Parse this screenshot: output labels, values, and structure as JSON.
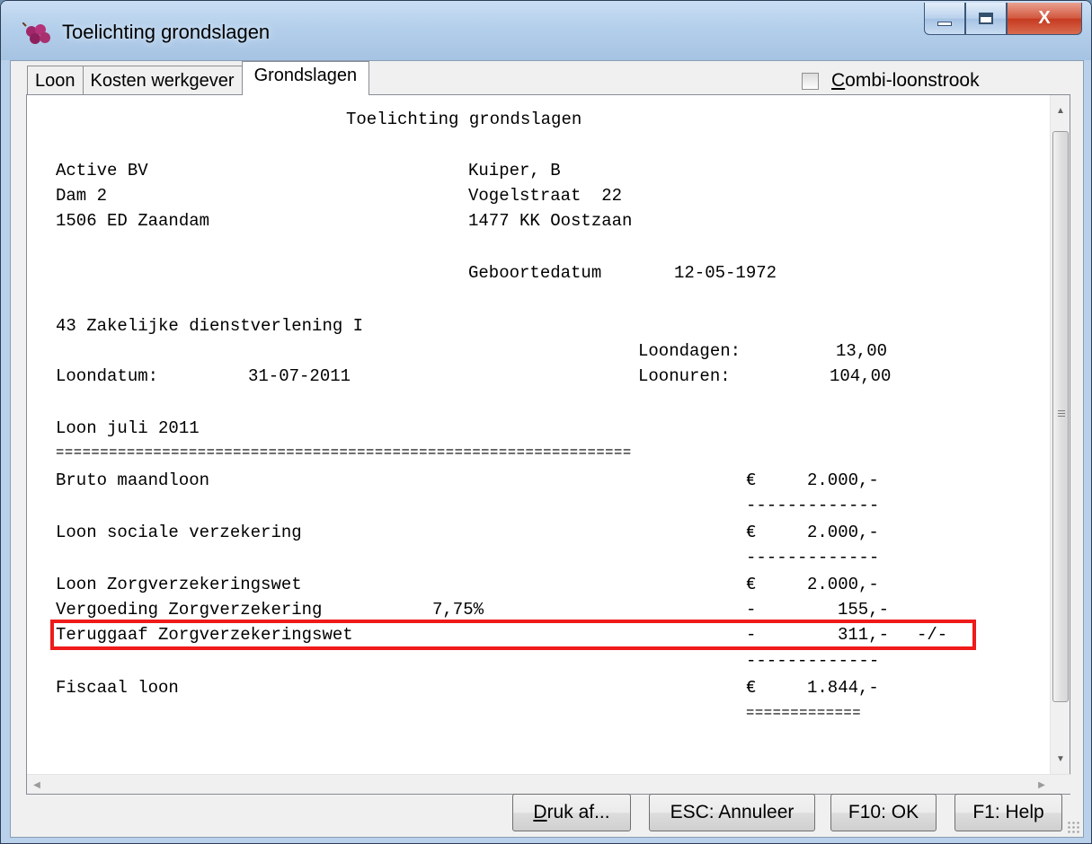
{
  "window": {
    "title": "Toelichting grondslagen",
    "app_icon": "grapes-icon",
    "controls": {
      "minimize": "minimize-icon",
      "maximize": "maximize-icon",
      "close": "X"
    }
  },
  "tabs": [
    {
      "label": "Loon",
      "active": false
    },
    {
      "label": "Kosten werkgever",
      "active": false
    },
    {
      "label": "Grondslagen",
      "active": true
    }
  ],
  "combi_checkbox": {
    "accel": "C",
    "rest": "ombi-loonstrook",
    "checked": false
  },
  "document": {
    "title": "Toelichting grondslagen",
    "employer": {
      "name": "Active BV",
      "street": "Dam 2",
      "city": "1506 ED Zaandam"
    },
    "employee": {
      "name": "Kuiper, B",
      "street": "Vogelstraat  22",
      "city": "1477 KK Oostzaan"
    },
    "birth_label": "Geboortedatum",
    "birth_date": "12-05-1972",
    "sector": "43 Zakelijke dienstverlening I",
    "loondagen_label": "Loondagen:",
    "loondagen_value": "13,00",
    "loondatum_label": "Loondatum:",
    "loondatum_value": "31-07-2011",
    "loonuren_label": "Loonuren:",
    "loonuren_value": "104,00",
    "period": "Loon juli 2011",
    "double_rule": "=================================================================",
    "single_rule": "-------------",
    "end_rule": "=============",
    "rows": {
      "bruto": {
        "label": "Bruto maandloon",
        "sign": "€",
        "amount": "2.000,-"
      },
      "sv": {
        "label": "Loon sociale verzekering",
        "sign": "€",
        "amount": "2.000,-"
      },
      "zvw": {
        "label": "Loon Zorgverzekeringswet",
        "sign": "€",
        "amount": "2.000,-"
      },
      "vergoeding": {
        "label": "Vergoeding Zorgverzekering",
        "pct": "7,75%",
        "sign": "-",
        "amount": "155,-"
      },
      "teruggaaf": {
        "label": "Teruggaaf Zorgverzekeringswet",
        "sign": "-",
        "amount": "311,-",
        "suffix": "-/-"
      },
      "fiscaal": {
        "label": "Fiscaal loon",
        "sign": "€",
        "amount": "1.844,-"
      }
    }
  },
  "buttons": {
    "print": {
      "accel": "D",
      "rest": "ruk af..."
    },
    "cancel": "ESC: Annuleer",
    "ok": "F10: OK",
    "help": "F1: Help"
  },
  "colors": {
    "highlight": "#ef1a1a",
    "title_bar": "#b4cfeb",
    "close_button": "#c5391f"
  }
}
